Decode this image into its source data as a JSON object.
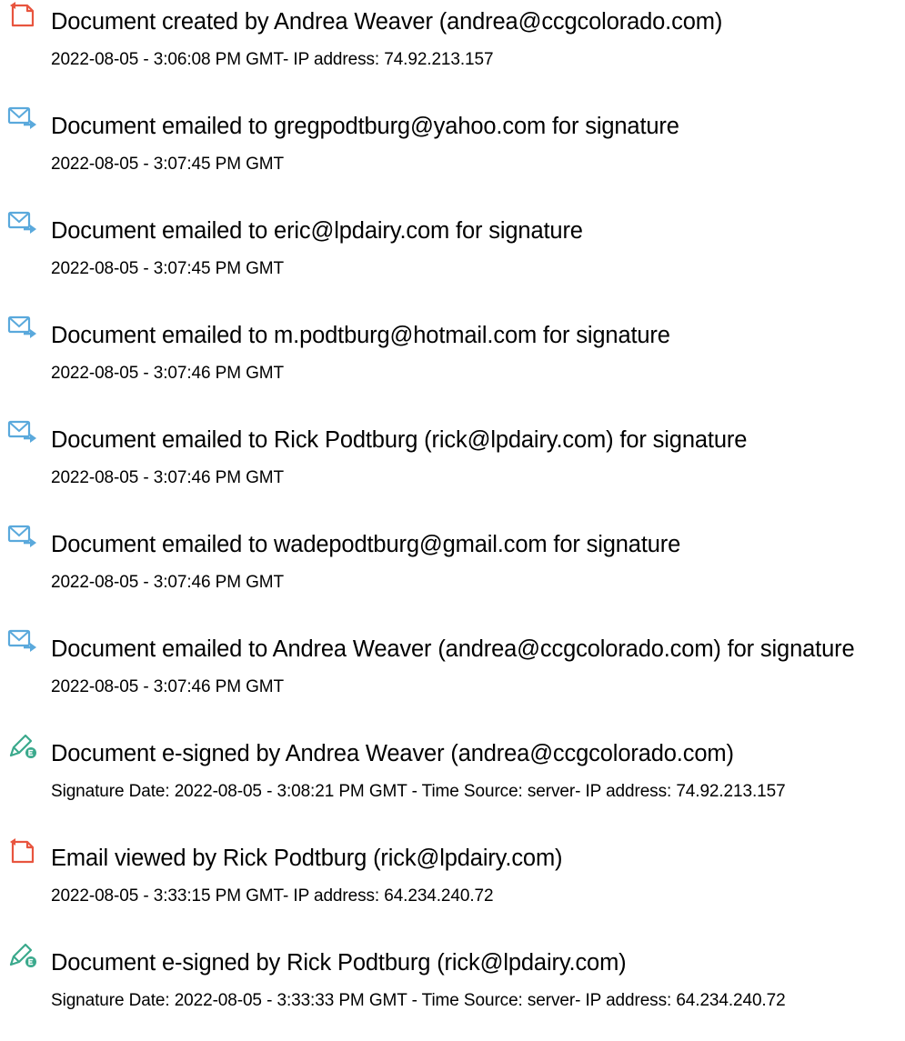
{
  "colors": {
    "doc_icon": "#e8553f",
    "mail_icon": "#5aa9dc",
    "sign_icon": "#3aa98c"
  },
  "events": [
    {
      "icon": "document-icon",
      "title": "Document created by Andrea Weaver (andrea@ccgcolorado.com)",
      "detail": "2022-08-05 - 3:06:08 PM GMT- IP address: 74.92.213.157"
    },
    {
      "icon": "email-icon",
      "title": "Document emailed to gregpodtburg@yahoo.com for signature",
      "detail": "2022-08-05 - 3:07:45 PM GMT"
    },
    {
      "icon": "email-icon",
      "title": "Document emailed to eric@lpdairy.com for signature",
      "detail": "2022-08-05 - 3:07:45 PM GMT"
    },
    {
      "icon": "email-icon",
      "title": "Document emailed to m.podtburg@hotmail.com for signature",
      "detail": "2022-08-05 - 3:07:46 PM GMT"
    },
    {
      "icon": "email-icon",
      "title": "Document emailed to Rick Podtburg (rick@lpdairy.com) for signature",
      "detail": "2022-08-05 - 3:07:46 PM GMT"
    },
    {
      "icon": "email-icon",
      "title": "Document emailed to wadepodtburg@gmail.com for signature",
      "detail": "2022-08-05 - 3:07:46 PM GMT"
    },
    {
      "icon": "email-icon",
      "title": "Document emailed to Andrea Weaver (andrea@ccgcolorado.com) for signature",
      "detail": "2022-08-05 - 3:07:46 PM GMT"
    },
    {
      "icon": "esign-icon",
      "title": "Document e-signed by Andrea Weaver (andrea@ccgcolorado.com)",
      "detail": "Signature Date: 2022-08-05 - 3:08:21 PM GMT - Time Source: server- IP address: 74.92.213.157"
    },
    {
      "icon": "document-icon",
      "title": "Email viewed by Rick Podtburg (rick@lpdairy.com)",
      "detail": "2022-08-05 - 3:33:15 PM GMT- IP address: 64.234.240.72"
    },
    {
      "icon": "esign-icon",
      "title": "Document e-signed by Rick Podtburg (rick@lpdairy.com)",
      "detail": "Signature Date: 2022-08-05 - 3:33:33 PM GMT - Time Source: server- IP address: 64.234.240.72"
    }
  ]
}
